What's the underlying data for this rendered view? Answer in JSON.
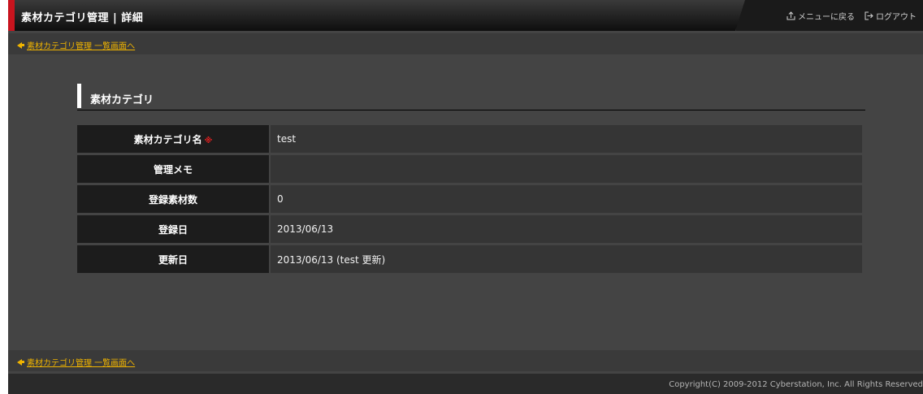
{
  "header": {
    "title": "素材カテゴリ管理 | 詳細",
    "menu_link": "メニューに戻る",
    "logout_link": "ログアウト"
  },
  "nav": {
    "back_link_top": "素材カテゴリ管理 一覧画面へ",
    "back_link_bottom": "素材カテゴリ管理 一覧画面へ"
  },
  "section": {
    "title": "素材カテゴリ"
  },
  "detail": {
    "rows": [
      {
        "label": "素材カテゴリ名",
        "value": "test",
        "required_mark": "※"
      },
      {
        "label": "管理メモ",
        "value": ""
      },
      {
        "label": "登録素材数",
        "value": "0"
      },
      {
        "label": "登録日",
        "value": "2013/06/13"
      },
      {
        "label": "更新日",
        "value": "2013/06/13 (test 更新)"
      }
    ]
  },
  "footer": {
    "copyright": "Copyright(C) 2009-2012 Cyberstation, Inc. All Rights Reserved"
  },
  "colors": {
    "accent_red": "#c8141e",
    "link_yellow": "#f0b400",
    "background": "#444444"
  },
  "icons": {
    "menu": "home-return-icon",
    "logout": "logout-icon",
    "back": "arrow-left-icon"
  }
}
